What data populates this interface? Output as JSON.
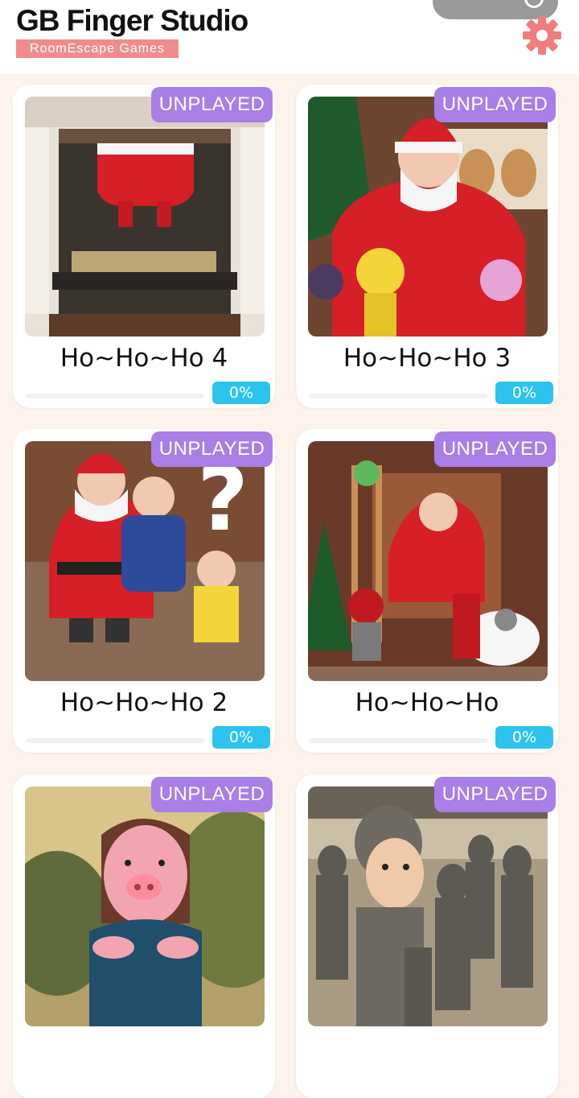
{
  "header": {
    "title": "GB Finger Studio",
    "subtitle": "RoomEscape Games",
    "settings_icon": "gear-icon",
    "accent": "#f08c8c"
  },
  "colors": {
    "badge": "#a97ee6",
    "progress": "#2cc4ef",
    "background": "#fdf3ec"
  },
  "games": [
    {
      "title": "Ho~Ho~Ho 4",
      "status": "UNPLAYED",
      "progress_label": "0%",
      "progress": 0
    },
    {
      "title": "Ho~Ho~Ho 3",
      "status": "UNPLAYED",
      "progress_label": "0%",
      "progress": 0
    },
    {
      "title": "Ho~Ho~Ho 2",
      "status": "UNPLAYED",
      "progress_label": "0%",
      "progress": 0
    },
    {
      "title": "Ho~Ho~Ho",
      "status": "UNPLAYED",
      "progress_label": "0%",
      "progress": 0
    },
    {
      "title": "",
      "status": "UNPLAYED"
    },
    {
      "title": "",
      "status": "UNPLAYED"
    }
  ]
}
